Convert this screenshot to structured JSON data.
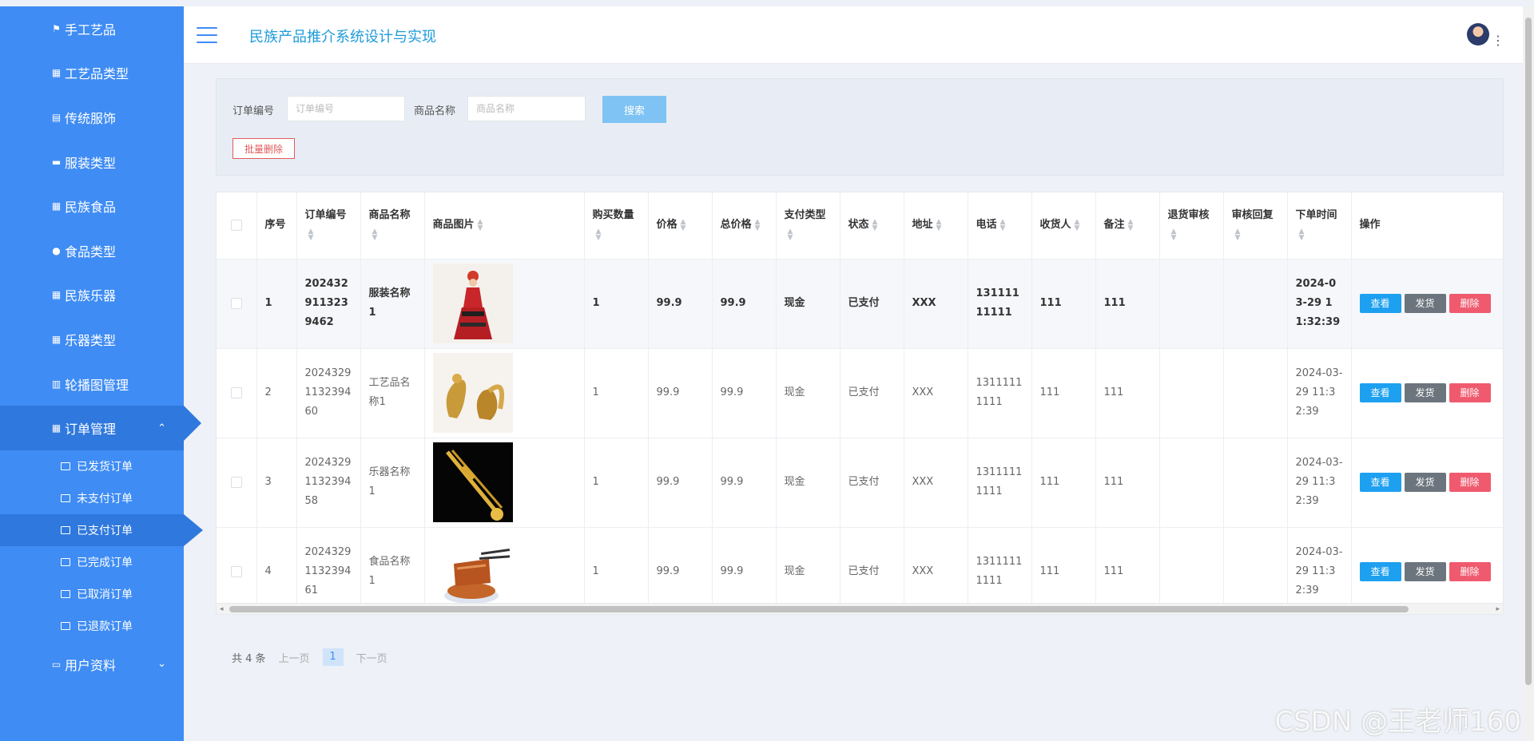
{
  "app": {
    "title": "民族产品推介系统设计与实现"
  },
  "sidebar": {
    "items": [
      {
        "label": "手工艺品",
        "icon": "flag-icon"
      },
      {
        "label": "工艺品类型",
        "icon": "grid-icon"
      },
      {
        "label": "传统服饰",
        "icon": "doc-icon"
      },
      {
        "label": "服装类型",
        "icon": "monitor-icon"
      },
      {
        "label": "民族食品",
        "icon": "grid-icon"
      },
      {
        "label": "食品类型",
        "icon": "user-icon"
      },
      {
        "label": "民族乐器",
        "icon": "grid-icon"
      },
      {
        "label": "乐器类型",
        "icon": "grid-icon"
      },
      {
        "label": "轮播图管理",
        "icon": "clipboard-icon"
      },
      {
        "label": "订单管理",
        "icon": "grid-icon"
      }
    ],
    "order_sub": [
      "已发货订单",
      "未支付订单",
      "已支付订单",
      "已完成订单",
      "已取消订单",
      "已退款订单"
    ],
    "user_menu": "用户资料"
  },
  "search": {
    "order_label": "订单编号",
    "order_placeholder": "订单编号",
    "product_label": "商品名称",
    "product_placeholder": "商品名称",
    "search_button": "搜索",
    "batch_delete": "批量删除"
  },
  "table": {
    "headers": [
      "序号",
      "订单编号",
      "商品名称",
      "商品图片",
      "购买数量",
      "价格",
      "总价格",
      "支付类型",
      "状态",
      "地址",
      "电话",
      "收货人",
      "备注",
      "退货审核",
      "审核回复",
      "下单时间",
      "操作"
    ],
    "rows": [
      {
        "idx": "1",
        "order": "2024329113239462",
        "name": "服装名称1",
        "qty": "1",
        "price": "99.9",
        "total": "99.9",
        "pay": "现金",
        "status": "已支付",
        "addr": "XXX",
        "phone": "13111111111",
        "receiver": "111",
        "note": "111",
        "ret": "",
        "reply": "",
        "time": "2024-03-29 11:32:39"
      },
      {
        "idx": "2",
        "order": "2024329113239460",
        "name": "工艺品名称1",
        "qty": "1",
        "price": "99.9",
        "total": "99.9",
        "pay": "现金",
        "status": "已支付",
        "addr": "XXX",
        "phone": "13111111111",
        "receiver": "111",
        "note": "111",
        "ret": "",
        "reply": "",
        "time": "2024-03-29 11:32:39"
      },
      {
        "idx": "3",
        "order": "2024329113239458",
        "name": "乐器名称1",
        "qty": "1",
        "price": "99.9",
        "total": "99.9",
        "pay": "现金",
        "status": "已支付",
        "addr": "XXX",
        "phone": "13111111111",
        "receiver": "111",
        "note": "111",
        "ret": "",
        "reply": "",
        "time": "2024-03-29 11:32:39"
      },
      {
        "idx": "4",
        "order": "2024329113239461",
        "name": "食品名称1",
        "qty": "1",
        "price": "99.9",
        "total": "99.9",
        "pay": "现金",
        "status": "已支付",
        "addr": "XXX",
        "phone": "13111111111",
        "receiver": "111",
        "note": "111",
        "ret": "",
        "reply": "",
        "time": "2024-03-29 11:32:39"
      }
    ],
    "actions": {
      "view": "查看",
      "ship": "发货",
      "delete": "删除"
    }
  },
  "pager": {
    "total": "共 4 条",
    "prev": "上一页",
    "current": "1",
    "next": "下一页"
  },
  "watermark": "CSDN @王老师160",
  "colors": {
    "sidebar": "#3f8cf4",
    "title": "#1f9bd9",
    "view": "#1ea0f0",
    "ship": "#6c757d",
    "delete": "#f05a6e"
  }
}
